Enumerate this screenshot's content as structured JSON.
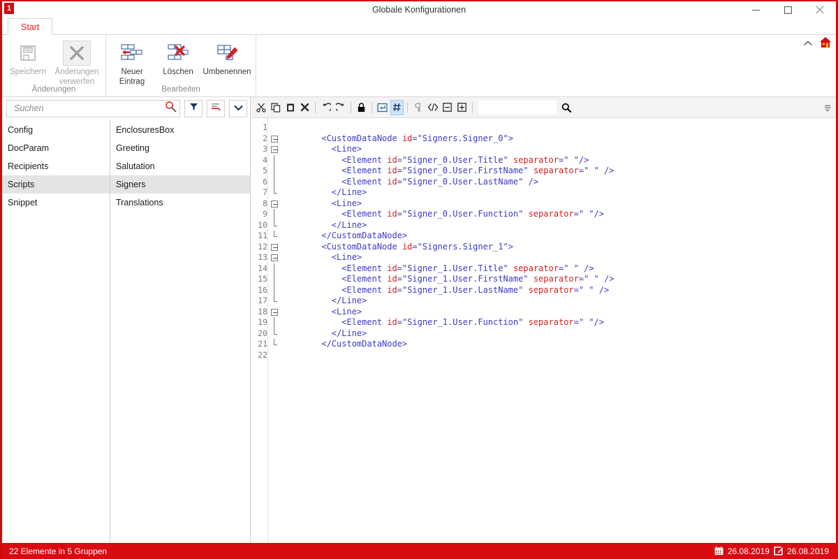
{
  "window": {
    "title": "Globale Konfigurationen",
    "logo_text": "1",
    "controls": {
      "minimize": "minimize-button",
      "maximize": "maximize-button",
      "close": "close-button"
    }
  },
  "ribbon": {
    "tabs": [
      {
        "label": "Start",
        "active": true
      }
    ],
    "groups": [
      {
        "label": "Änderungen",
        "buttons": [
          {
            "label": "Speichern",
            "icon": "save-icon",
            "disabled": true,
            "hover": false
          },
          {
            "label": "Änderungen verwerfen",
            "icon": "discard-changes-icon",
            "disabled": true,
            "hover": true
          }
        ]
      },
      {
        "label": "Bearbeiten",
        "buttons": [
          {
            "label": "Neuer Eintrag",
            "icon": "new-entry-icon",
            "disabled": false,
            "hover": false
          },
          {
            "label": "Löschen",
            "icon": "delete-icon",
            "disabled": false,
            "hover": false
          },
          {
            "label": "Umbenennen",
            "icon": "rename-icon",
            "disabled": false,
            "hover": false
          }
        ]
      }
    ],
    "corner": {
      "collapse_icon": "chevron-up-icon",
      "home_icon": "home-icon"
    }
  },
  "left_panel": {
    "search": {
      "placeholder": "Suchen",
      "value": "",
      "icon": "search-icon"
    },
    "buttons": [
      {
        "name": "filter-button",
        "icon": "filter-icon"
      },
      {
        "name": "sort-button",
        "icon": "sort-ascending-icon"
      },
      {
        "name": "more-options-button",
        "icon": "chevron-down-icon"
      }
    ],
    "group_list": [
      {
        "label": "Config",
        "selected": false
      },
      {
        "label": "DocParam",
        "selected": false
      },
      {
        "label": "Recipients",
        "selected": false
      },
      {
        "label": "Scripts",
        "selected": true
      },
      {
        "label": "Snippet",
        "selected": false
      }
    ],
    "item_list": [
      {
        "label": "EnclosuresBox",
        "selected": false
      },
      {
        "label": "Greeting",
        "selected": false
      },
      {
        "label": "Salutation",
        "selected": false
      },
      {
        "label": "Signers",
        "selected": true
      },
      {
        "label": "Translations",
        "selected": false
      }
    ]
  },
  "editor": {
    "toolbar": [
      {
        "name": "cut-button",
        "icon": "scissors-icon",
        "active": false
      },
      {
        "name": "copy-button",
        "icon": "copy-icon",
        "active": false
      },
      {
        "name": "paste-button",
        "icon": "paste-icon",
        "active": false
      },
      {
        "name": "delete-button",
        "icon": "x-mark-icon",
        "active": false
      },
      {
        "name": "undo-button",
        "icon": "undo-icon",
        "active": false
      },
      {
        "name": "redo-button",
        "icon": "redo-icon",
        "active": false
      },
      {
        "name": "readonly-lock-button",
        "icon": "lock-icon",
        "active": false
      },
      {
        "name": "word-wrap-button",
        "icon": "wrap-text-icon",
        "active": false
      },
      {
        "name": "line-numbers-button",
        "icon": "hash-icon",
        "active": true
      },
      {
        "name": "show-whitespace-button",
        "icon": "pilcrow-icon",
        "active": false
      },
      {
        "name": "format-code-button",
        "icon": "code-brackets-icon",
        "active": false
      },
      {
        "name": "collapse-all-button",
        "icon": "minus-box-icon",
        "active": false
      },
      {
        "name": "expand-all-button",
        "icon": "plus-box-icon",
        "active": false
      }
    ],
    "find": {
      "value": "",
      "placeholder": "",
      "icon": "search-icon"
    },
    "overflow_icon": "toolbar-overflow-icon",
    "total_lines": 22,
    "code_lines": [
      {
        "num": 1,
        "indent": 0,
        "fold": "none",
        "tokens": []
      },
      {
        "num": 2,
        "indent": 6,
        "fold": "open",
        "tokens": [
          {
            "t": "<CustomDataNode ",
            "c": "tagname"
          },
          {
            "t": "id",
            "c": "attr"
          },
          {
            "t": "=",
            "c": "punct"
          },
          {
            "t": "\"Signers.Signer_0\"",
            "c": "val"
          },
          {
            "t": ">",
            "c": "tagname"
          }
        ]
      },
      {
        "num": 3,
        "indent": 8,
        "fold": "open",
        "tokens": [
          {
            "t": "<Line>",
            "c": "tagname"
          }
        ]
      },
      {
        "num": 4,
        "indent": 10,
        "fold": "body",
        "tokens": [
          {
            "t": "<Element ",
            "c": "tagname"
          },
          {
            "t": "id",
            "c": "attr"
          },
          {
            "t": "=",
            "c": "punct"
          },
          {
            "t": "\"Signer_0.User.Title\" ",
            "c": "val"
          },
          {
            "t": "separator",
            "c": "attr"
          },
          {
            "t": "=",
            "c": "punct"
          },
          {
            "t": "\" \"",
            "c": "val"
          },
          {
            "t": "/>",
            "c": "tagname"
          }
        ]
      },
      {
        "num": 5,
        "indent": 10,
        "fold": "body",
        "tokens": [
          {
            "t": "<Element ",
            "c": "tagname"
          },
          {
            "t": "id",
            "c": "attr"
          },
          {
            "t": "=",
            "c": "punct"
          },
          {
            "t": "\"Signer_0.User.FirstName\" ",
            "c": "val"
          },
          {
            "t": "separator",
            "c": "attr"
          },
          {
            "t": "=",
            "c": "punct"
          },
          {
            "t": "\" \" ",
            "c": "val"
          },
          {
            "t": "/>",
            "c": "tagname"
          }
        ]
      },
      {
        "num": 6,
        "indent": 10,
        "fold": "body",
        "tokens": [
          {
            "t": "<Element ",
            "c": "tagname"
          },
          {
            "t": "id",
            "c": "attr"
          },
          {
            "t": "=",
            "c": "punct"
          },
          {
            "t": "\"Signer_0.User.LastName\" ",
            "c": "val"
          },
          {
            "t": "/>",
            "c": "tagname"
          }
        ]
      },
      {
        "num": 7,
        "indent": 8,
        "fold": "close",
        "tokens": [
          {
            "t": "</Line>",
            "c": "tagname"
          }
        ]
      },
      {
        "num": 8,
        "indent": 8,
        "fold": "open",
        "tokens": [
          {
            "t": "<Line>",
            "c": "tagname"
          }
        ]
      },
      {
        "num": 9,
        "indent": 10,
        "fold": "body",
        "tokens": [
          {
            "t": "<Element ",
            "c": "tagname"
          },
          {
            "t": "id",
            "c": "attr"
          },
          {
            "t": "=",
            "c": "punct"
          },
          {
            "t": "\"Signer_0.User.Function\" ",
            "c": "val"
          },
          {
            "t": "separator",
            "c": "attr"
          },
          {
            "t": "=",
            "c": "punct"
          },
          {
            "t": "\" \"",
            "c": "val"
          },
          {
            "t": "/>",
            "c": "tagname"
          }
        ]
      },
      {
        "num": 10,
        "indent": 8,
        "fold": "close",
        "tokens": [
          {
            "t": "</Line>",
            "c": "tagname"
          }
        ]
      },
      {
        "num": 11,
        "indent": 6,
        "fold": "close-outer",
        "tokens": [
          {
            "t": "</CustomDataNode>",
            "c": "tagname"
          }
        ]
      },
      {
        "num": 12,
        "indent": 6,
        "fold": "open",
        "tokens": [
          {
            "t": "<CustomDataNode ",
            "c": "tagname"
          },
          {
            "t": "id",
            "c": "attr"
          },
          {
            "t": "=",
            "c": "punct"
          },
          {
            "t": "\"Signers.Signer_1\"",
            "c": "val"
          },
          {
            "t": ">",
            "c": "tagname"
          }
        ]
      },
      {
        "num": 13,
        "indent": 8,
        "fold": "open",
        "tokens": [
          {
            "t": "<Line>",
            "c": "tagname"
          }
        ]
      },
      {
        "num": 14,
        "indent": 10,
        "fold": "body",
        "tokens": [
          {
            "t": "<Element ",
            "c": "tagname"
          },
          {
            "t": "id",
            "c": "attr"
          },
          {
            "t": "=",
            "c": "punct"
          },
          {
            "t": "\"Signer_1.User.Title\" ",
            "c": "val"
          },
          {
            "t": "separator",
            "c": "attr"
          },
          {
            "t": "=",
            "c": "punct"
          },
          {
            "t": "\" \" ",
            "c": "val"
          },
          {
            "t": "/>",
            "c": "tagname"
          }
        ]
      },
      {
        "num": 15,
        "indent": 10,
        "fold": "body",
        "tokens": [
          {
            "t": "<Element ",
            "c": "tagname"
          },
          {
            "t": "id",
            "c": "attr"
          },
          {
            "t": "=",
            "c": "punct"
          },
          {
            "t": "\"Signer_1.User.FirstName\" ",
            "c": "val"
          },
          {
            "t": "separator",
            "c": "attr"
          },
          {
            "t": "=",
            "c": "punct"
          },
          {
            "t": "\" \" ",
            "c": "val"
          },
          {
            "t": "/>",
            "c": "tagname"
          }
        ]
      },
      {
        "num": 16,
        "indent": 10,
        "fold": "body",
        "tokens": [
          {
            "t": "<Element ",
            "c": "tagname"
          },
          {
            "t": "id",
            "c": "attr"
          },
          {
            "t": "=",
            "c": "punct"
          },
          {
            "t": "\"Signer_1.User.LastName\" ",
            "c": "val"
          },
          {
            "t": "separator",
            "c": "attr"
          },
          {
            "t": "=",
            "c": "punct"
          },
          {
            "t": "\" \" ",
            "c": "val"
          },
          {
            "t": "/>",
            "c": "tagname"
          }
        ]
      },
      {
        "num": 17,
        "indent": 8,
        "fold": "close",
        "tokens": [
          {
            "t": "</Line>",
            "c": "tagname"
          }
        ]
      },
      {
        "num": 18,
        "indent": 8,
        "fold": "open",
        "tokens": [
          {
            "t": "<Line>",
            "c": "tagname"
          }
        ]
      },
      {
        "num": 19,
        "indent": 10,
        "fold": "body",
        "tokens": [
          {
            "t": "<Element ",
            "c": "tagname"
          },
          {
            "t": "id",
            "c": "attr"
          },
          {
            "t": "=",
            "c": "punct"
          },
          {
            "t": "\"Signer_1.User.Function\" ",
            "c": "val"
          },
          {
            "t": "separator",
            "c": "attr"
          },
          {
            "t": "=",
            "c": "punct"
          },
          {
            "t": "\" \"",
            "c": "val"
          },
          {
            "t": "/>",
            "c": "tagname"
          }
        ]
      },
      {
        "num": 20,
        "indent": 8,
        "fold": "close",
        "tokens": [
          {
            "t": "</Line>",
            "c": "tagname"
          }
        ]
      },
      {
        "num": 21,
        "indent": 6,
        "fold": "close-outer",
        "tokens": [
          {
            "t": "</CustomDataNode>",
            "c": "tagname"
          }
        ]
      },
      {
        "num": 22,
        "indent": 0,
        "fold": "none",
        "tokens": []
      }
    ]
  },
  "statusbar": {
    "left_text": "22 Elemente in 5 Gruppen",
    "created_icon": "calendar-icon",
    "created_date": "26.08.2019",
    "modified_icon": "edit-document-icon",
    "modified_date": "26.08.2019"
  },
  "colors": {
    "brand_red": "#d90a12",
    "tag_blue": "#3b3bc4",
    "attr_red": "#d42020",
    "selection_grey": "#e4e4e4",
    "active_toolbar_blue": "#cfe3f7"
  }
}
